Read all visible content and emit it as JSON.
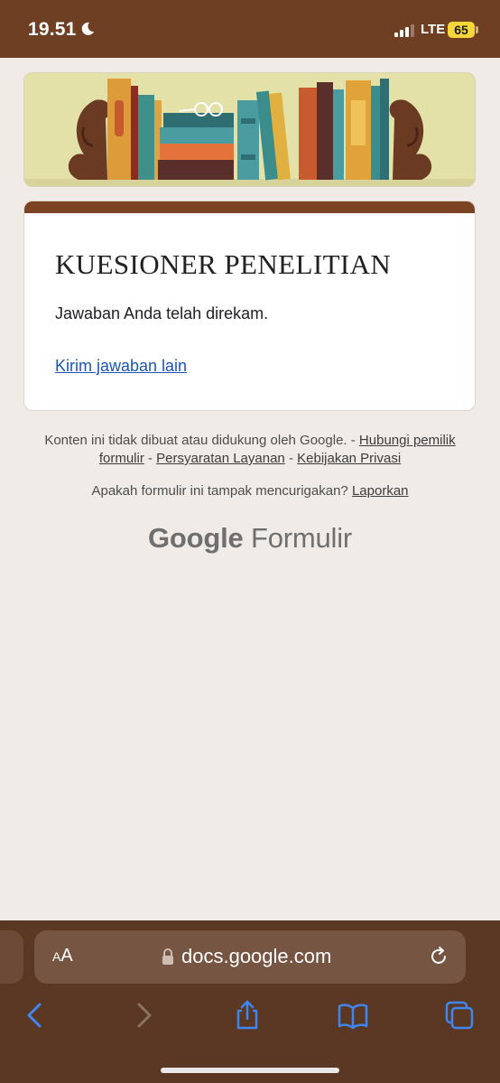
{
  "status_bar": {
    "time": "19.51",
    "network": "LTE",
    "battery": "65",
    "icons": [
      "moon-icon",
      "signal-icon"
    ]
  },
  "form": {
    "title": "KUESIONER PENELITIAN",
    "confirmation": "Jawaban Anda telah direkam.",
    "resubmit_link": "Kirim jawaban lain",
    "accent_color": "#7b4321"
  },
  "footer": {
    "disclaimer_text": "Konten ini tidak dibuat atau didukung oleh Google. - ",
    "contact_owner": "Hubungi pemilik formulir",
    "separator": " - ",
    "terms": "Persyaratan Layanan",
    "privacy": "Kebijakan Privasi",
    "suspicious_question": "Apakah formulir ini tampak mencurigakan? ",
    "report_link": "Laporkan",
    "logo_google": "Google",
    "logo_product": "Formulir"
  },
  "browser": {
    "text_size_small": "A",
    "text_size_large": "A",
    "url": "docs.google.com",
    "icons": [
      "lock-icon",
      "reload-icon",
      "back-icon",
      "forward-icon",
      "share-icon",
      "bookmarks-icon",
      "tabs-icon"
    ]
  }
}
